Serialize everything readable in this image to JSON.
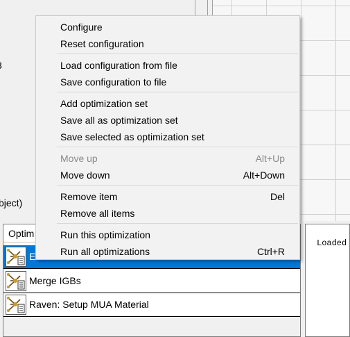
{
  "background": {
    "left_fragment_char": "3",
    "left_fragment_text": "bject)",
    "list_header": "Optim",
    "rows": [
      {
        "label": "E",
        "selected": true
      },
      {
        "label": "Merge IGBs",
        "selected": false
      },
      {
        "label": "Raven: Setup MUA Material",
        "selected": false
      }
    ],
    "log_text": "Loaded"
  },
  "menu": {
    "groups": [
      [
        {
          "label": "Configure",
          "shortcut": "",
          "enabled": true
        },
        {
          "label": "Reset configuration",
          "shortcut": "",
          "enabled": true
        }
      ],
      [
        {
          "label": "Load configuration from file",
          "shortcut": "",
          "enabled": true
        },
        {
          "label": "Save configuration to file",
          "shortcut": "",
          "enabled": true
        }
      ],
      [
        {
          "label": "Add optimization set",
          "shortcut": "",
          "enabled": true
        },
        {
          "label": "Save all as optimization set",
          "shortcut": "",
          "enabled": true
        },
        {
          "label": "Save selected as optimization set",
          "shortcut": "",
          "enabled": true
        }
      ],
      [
        {
          "label": "Move up",
          "shortcut": "Alt+Up",
          "enabled": false
        },
        {
          "label": "Move down",
          "shortcut": "Alt+Down",
          "enabled": true
        }
      ],
      [
        {
          "label": "Remove item",
          "shortcut": "Del",
          "enabled": true
        },
        {
          "label": "Remove all items",
          "shortcut": "",
          "enabled": true
        }
      ],
      [
        {
          "label": "Run this optimization",
          "shortcut": "",
          "enabled": true
        },
        {
          "label": "Run all optimizations",
          "shortcut": "Ctrl+R",
          "enabled": true
        }
      ]
    ]
  },
  "colors": {
    "selection": "#0078d7",
    "menu_bg": "#f2f2f2",
    "disabled_text": "#8a8a8a"
  }
}
